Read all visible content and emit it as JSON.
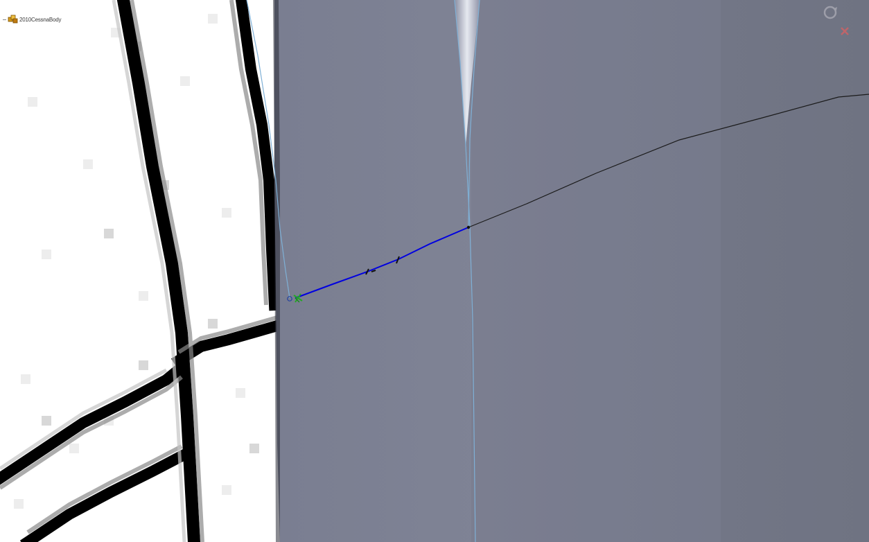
{
  "feature_tree": {
    "root_label": "2010CessnaBody",
    "root_icon": "part-icon"
  },
  "view_controls": {
    "rotate_icon": "rotate-view-icon",
    "close_icon": "close-icon"
  },
  "colors": {
    "surface_base": "#7b7f91",
    "surface_edge_highlight": "#d8dde8",
    "sketch_active": "#0000e0",
    "sketch_inactive": "#1a1a1a",
    "reference_line": "#7fb0d6",
    "endpoint_marker": "#22aa22",
    "close_icon": "#e06060",
    "rotate_icon": "#a9a9b3",
    "blueprint_line": "#000000",
    "blueprint_background": "#ffffff"
  }
}
